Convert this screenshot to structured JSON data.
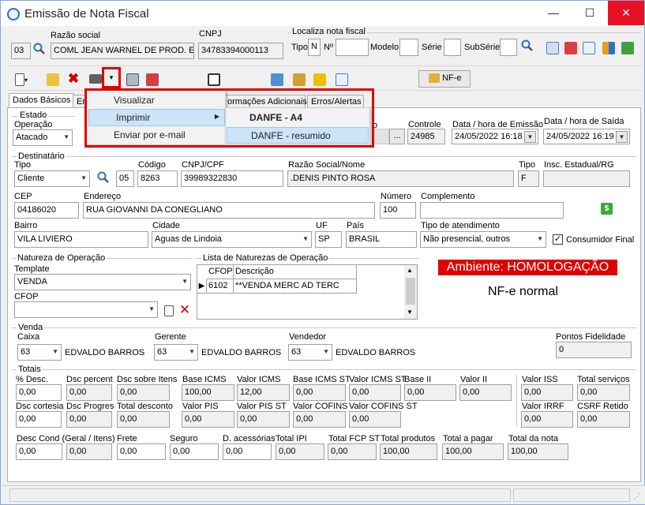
{
  "window": {
    "title": "Emissão de Nota Fiscal",
    "minimize": "—",
    "maximize": "☐",
    "close": "✕"
  },
  "header": {
    "razao_label": "Razão social",
    "cnpj_label": "CNPJ",
    "code": "03",
    "razao": "COML JEAN WARNEL DE PROD. ESP.",
    "cnpj": "34783394000113",
    "localiza_label": "Localiza nota fiscal",
    "tipo_label": "Tipo",
    "tipo_value": "N",
    "numero_label": "Nº",
    "modelo_label": "Modelo",
    "serie_label": "Série",
    "subserie_label": "SubSérie"
  },
  "toolbar": {
    "nfe_label": "NF-e"
  },
  "tabs": [
    "Dados Básicos",
    "En",
    "ormações Adicionais",
    "Erros/Alertas"
  ],
  "menu": {
    "items": [
      "Visualizar",
      "Imprimir",
      "Enviar por e-mail"
    ],
    "submenu": [
      "DANFE - A4",
      "DANFE - resumido"
    ]
  },
  "estado": {
    "group_title": "Estado",
    "operacao_label": "Operação",
    "operacao_value": "Atacado",
    "controle_label": "Controle",
    "controle_value": "24985",
    "ellipsis": "...",
    "partial_label": "o",
    "data_emissao_label": "Data / hora de Emissão",
    "data_emissao_value": "24/05/2022 16:18",
    "data_saida_label": "Data / hora de Saída",
    "data_saida_value": "24/05/2022 16:19"
  },
  "destinatario": {
    "group_title": "Destinatário",
    "tipo_label": "Tipo",
    "tipo_value": "Cliente",
    "codigo_label": "Código",
    "codigo_prefix": "05",
    "codigo_value": "8263",
    "cnpjcpf_label": "CNPJ/CPF",
    "cnpjcpf_value": "39989322830",
    "razao_label": "Razão Social/Nome",
    "razao_value": ".DENIS PINTO ROSA",
    "tipo2_label": "Tipo",
    "tipo2_value": "F",
    "ie_label": "Insc. Estadual/RG",
    "cep_label": "CEP",
    "cep_value": "04186020",
    "endereco_label": "Endereço",
    "endereco_value": "RUA GIOVANNI DA CONEGLIANO",
    "numero_label": "Número",
    "numero_value": "100",
    "complemento_label": "Complemento",
    "bairro_label": "Bairro",
    "bairro_value": "VILA LIVIERO",
    "cidade_label": "Cidade",
    "cidade_value": "Aguas de Lindoia",
    "uf_label": "UF",
    "uf_value": "SP",
    "pais_label": "País",
    "pais_value": "BRASIL",
    "atendimento_label": "Tipo de atendimento",
    "atendimento_value": "Não presencial, outros",
    "consumidor_label": "Consumidor Final",
    "consumidor_checked": "✓"
  },
  "natureza": {
    "group_title": "Natureza de Operação",
    "template_label": "Template",
    "template_value": "VENDA",
    "cfop_label": "CFOP",
    "lista_title": "Lista de Naturezas de Operação",
    "col_cfop": "CFOP",
    "col_desc": "Descrição",
    "row_cfop": "6102",
    "row_desc": "**VENDA MERC AD TERC"
  },
  "ambiente": {
    "label": "Ambiente: HOMOLOGAÇÃO",
    "nfe_status": "NF-e normal"
  },
  "venda": {
    "group_title": "Venda",
    "caixa_label": "Caixa",
    "caixa_code": "63",
    "caixa_name": "EDVALDO BARROS",
    "gerente_label": "Gerente",
    "gerente_code": "63",
    "gerente_name": "EDVALDO BARROS",
    "vendedor_label": "Vendedor",
    "vendedor_code": "63",
    "vendedor_name": "EDVALDO BARROS",
    "pontos_label": "Pontos Fidelidade",
    "pontos_value": "0"
  },
  "totais": {
    "group_title": "Totais",
    "row1": [
      {
        "label": "% Desc.",
        "value": "0,00"
      },
      {
        "label": "Dsc percent",
        "value": "0,00"
      },
      {
        "label": "Dsc sobre Itens",
        "value": "0,00"
      },
      {
        "label": "Base ICMS",
        "value": "100,00"
      },
      {
        "label": "Valor ICMS",
        "value": "12,00"
      },
      {
        "label": "Base ICMS ST",
        "value": "0,00"
      },
      {
        "label": "Valor ICMS ST",
        "value": "0,00"
      },
      {
        "label": "Base II",
        "value": "0,00"
      },
      {
        "label": "Valor II",
        "value": "0,00"
      },
      {
        "label": "Valor ISS",
        "value": "0,00"
      },
      {
        "label": "Total serviços",
        "value": "0,00"
      }
    ],
    "row2": [
      {
        "label": "Dsc cortesia",
        "value": "0,00"
      },
      {
        "label": "Dsc Progres",
        "value": "0,00"
      },
      {
        "label": "Total desconto",
        "value": "0,00"
      },
      {
        "label": "Valor PIS",
        "value": "0,00"
      },
      {
        "label": "Valor PIS ST",
        "value": "0,00"
      },
      {
        "label": "Valor COFINS",
        "value": "0,00"
      },
      {
        "label": "Valor COFINS ST",
        "value": "0,00"
      },
      {
        "label": "Valor IRRF",
        "value": "0,00"
      },
      {
        "label": "CSRF Retido",
        "value": "0,00"
      }
    ],
    "row3": [
      {
        "label": "Desc Cond (Geral / Itens)",
        "value": "0,00"
      },
      {
        "label": "",
        "value": "0,00"
      },
      {
        "label": "Frete",
        "value": "0,00"
      },
      {
        "label": "Seguro",
        "value": "0,00"
      },
      {
        "label": "D. acessórias",
        "value": "0,00"
      },
      {
        "label": "Total IPI",
        "value": "0,00"
      },
      {
        "label": "Total FCP ST",
        "value": "0,00"
      },
      {
        "label": "Total produtos",
        "value": "100,00"
      },
      {
        "label": "Total a pagar",
        "value": "100,00"
      },
      {
        "label": "Total da nota",
        "value": "100,00"
      }
    ]
  },
  "colors": {
    "ambiente_bg": "#e00000",
    "highlight": "#e00000",
    "menu_sel": "#cce4f7"
  }
}
